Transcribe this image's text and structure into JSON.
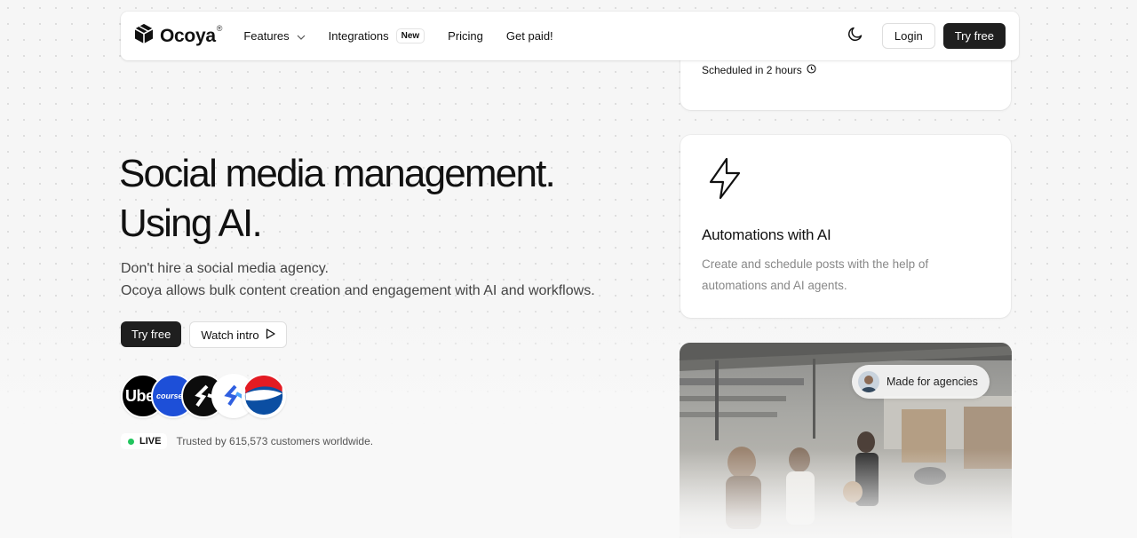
{
  "navbar": {
    "logo_text": "Ocoya",
    "logo_mark": "®",
    "items": [
      {
        "label": "Features"
      },
      {
        "label": "Integrations",
        "badge": "New"
      },
      {
        "label": "Pricing"
      },
      {
        "label": "Get paid!"
      }
    ],
    "login_label": "Login",
    "try_label": "Try free"
  },
  "hero": {
    "title_line1": "Social media management.",
    "title_line2": "Using AI.",
    "sub_line1": "Don't hire a social media agency.",
    "sub_line2": "Ocoya allows bulk content creation and engagement with AI and workflows.",
    "cta_try": "Try free",
    "cta_watch": "Watch intro",
    "brands": [
      {
        "name": "uber",
        "text": "Uber"
      },
      {
        "name": "coursera",
        "text": "coursera"
      },
      {
        "name": "s-brand",
        "text": ""
      },
      {
        "name": "t-brand",
        "text": ""
      },
      {
        "name": "pepsi",
        "text": ""
      }
    ],
    "live_label": "LIVE",
    "trust_text": "Trusted by 615,573 customers worldwide."
  },
  "cards": {
    "scheduled_text": "Scheduled in 2 hours",
    "automation_title": "Automations with AI",
    "automation_desc": "Create and schedule posts with the help of automations and AI agents.",
    "agency_pill": "Made for agencies"
  },
  "colors": {
    "dark_button": "#1f1f1f",
    "live_dot": "#22c55e",
    "page_bg": "#f6f6f6"
  }
}
